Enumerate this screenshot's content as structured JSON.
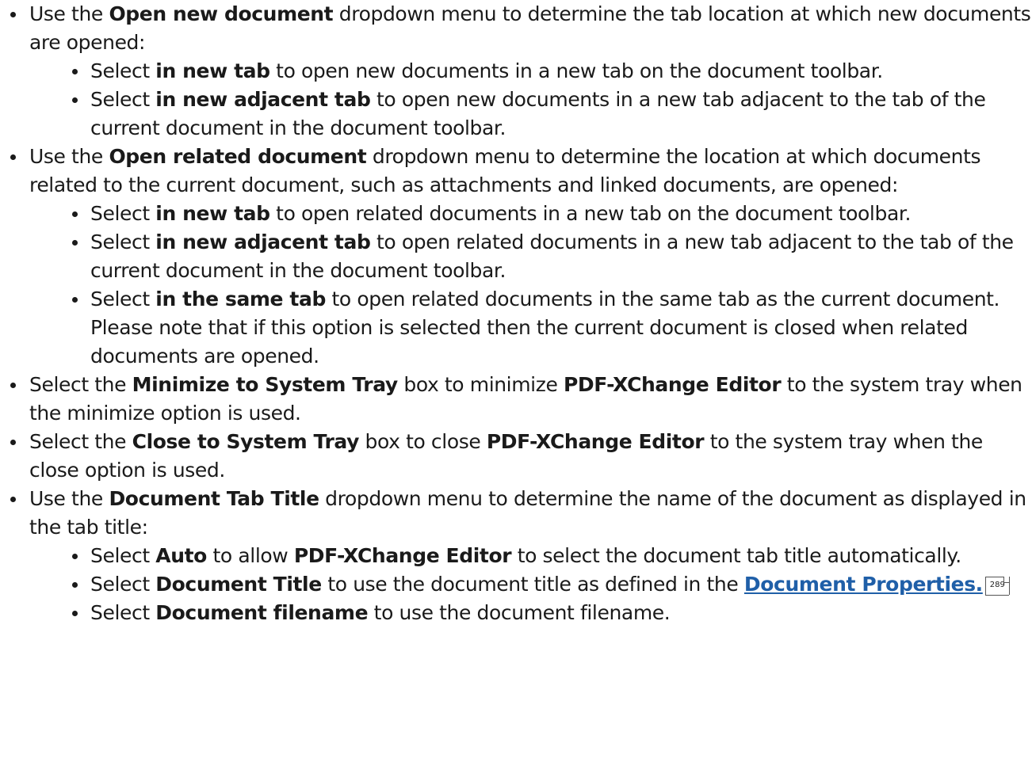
{
  "items": [
    {
      "parts": [
        "Use the ",
        "Open new document",
        " dropdown menu to determine the tab location at which new documents are opened:"
      ],
      "sub": [
        [
          "Select ",
          "in new tab",
          " to open new documents in a new tab on the document toolbar."
        ],
        [
          "Select ",
          "in new adjacent tab",
          " to open new documents in a new tab adjacent to the tab of the current document in the document toolbar."
        ]
      ]
    },
    {
      "parts": [
        "Use the ",
        "Open related document",
        " dropdown menu to determine the location at which documents related to the current document, such as attachments and linked documents, are opened:"
      ],
      "sub": [
        [
          "Select ",
          "in new tab",
          " to open related documents in a new tab on the document toolbar."
        ],
        [
          "Select ",
          "in new adjacent tab",
          " to open related documents in a new tab adjacent to the tab of the current document in the document toolbar."
        ],
        [
          "Select ",
          "in the same tab",
          " to open related documents in the same tab as the current document. Please note that if this option is selected then the current document is closed when related documents are opened."
        ]
      ]
    },
    {
      "parts": [
        "Select the ",
        "Minimize to System Tray",
        " box to minimize ",
        "PDF-XChange Editor",
        " to the system tray when the minimize option is used."
      ]
    },
    {
      "parts": [
        "Select the ",
        "Close to System Tray",
        " box to close ",
        "PDF-XChange Editor",
        " to the system tray when the close option is used."
      ]
    },
    {
      "parts": [
        "Use the ",
        "Document Tab Title",
        " dropdown menu to determine the name of the document as displayed in the tab title:"
      ],
      "sub": [
        [
          "Select ",
          "Auto",
          " to allow ",
          "PDF-XChange Editor",
          " to select the document tab title automatically."
        ],
        [
          "Select ",
          "Document Title",
          " to use the document title as defined in the "
        ],
        [
          "Select ",
          "Document filename",
          " to use the document filename."
        ]
      ]
    }
  ],
  "link": {
    "text": "Document Properties.",
    "page_ref": "289"
  }
}
